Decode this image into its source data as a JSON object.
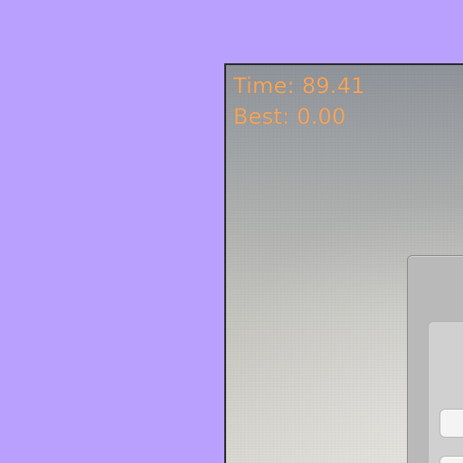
{
  "hud": {
    "time_label": "Time:",
    "time_value": "89.41",
    "best_label": "Best:",
    "best_value": "0.00"
  },
  "colors": {
    "background": "#b9a0ff",
    "hud_text": "#f3a45d"
  }
}
